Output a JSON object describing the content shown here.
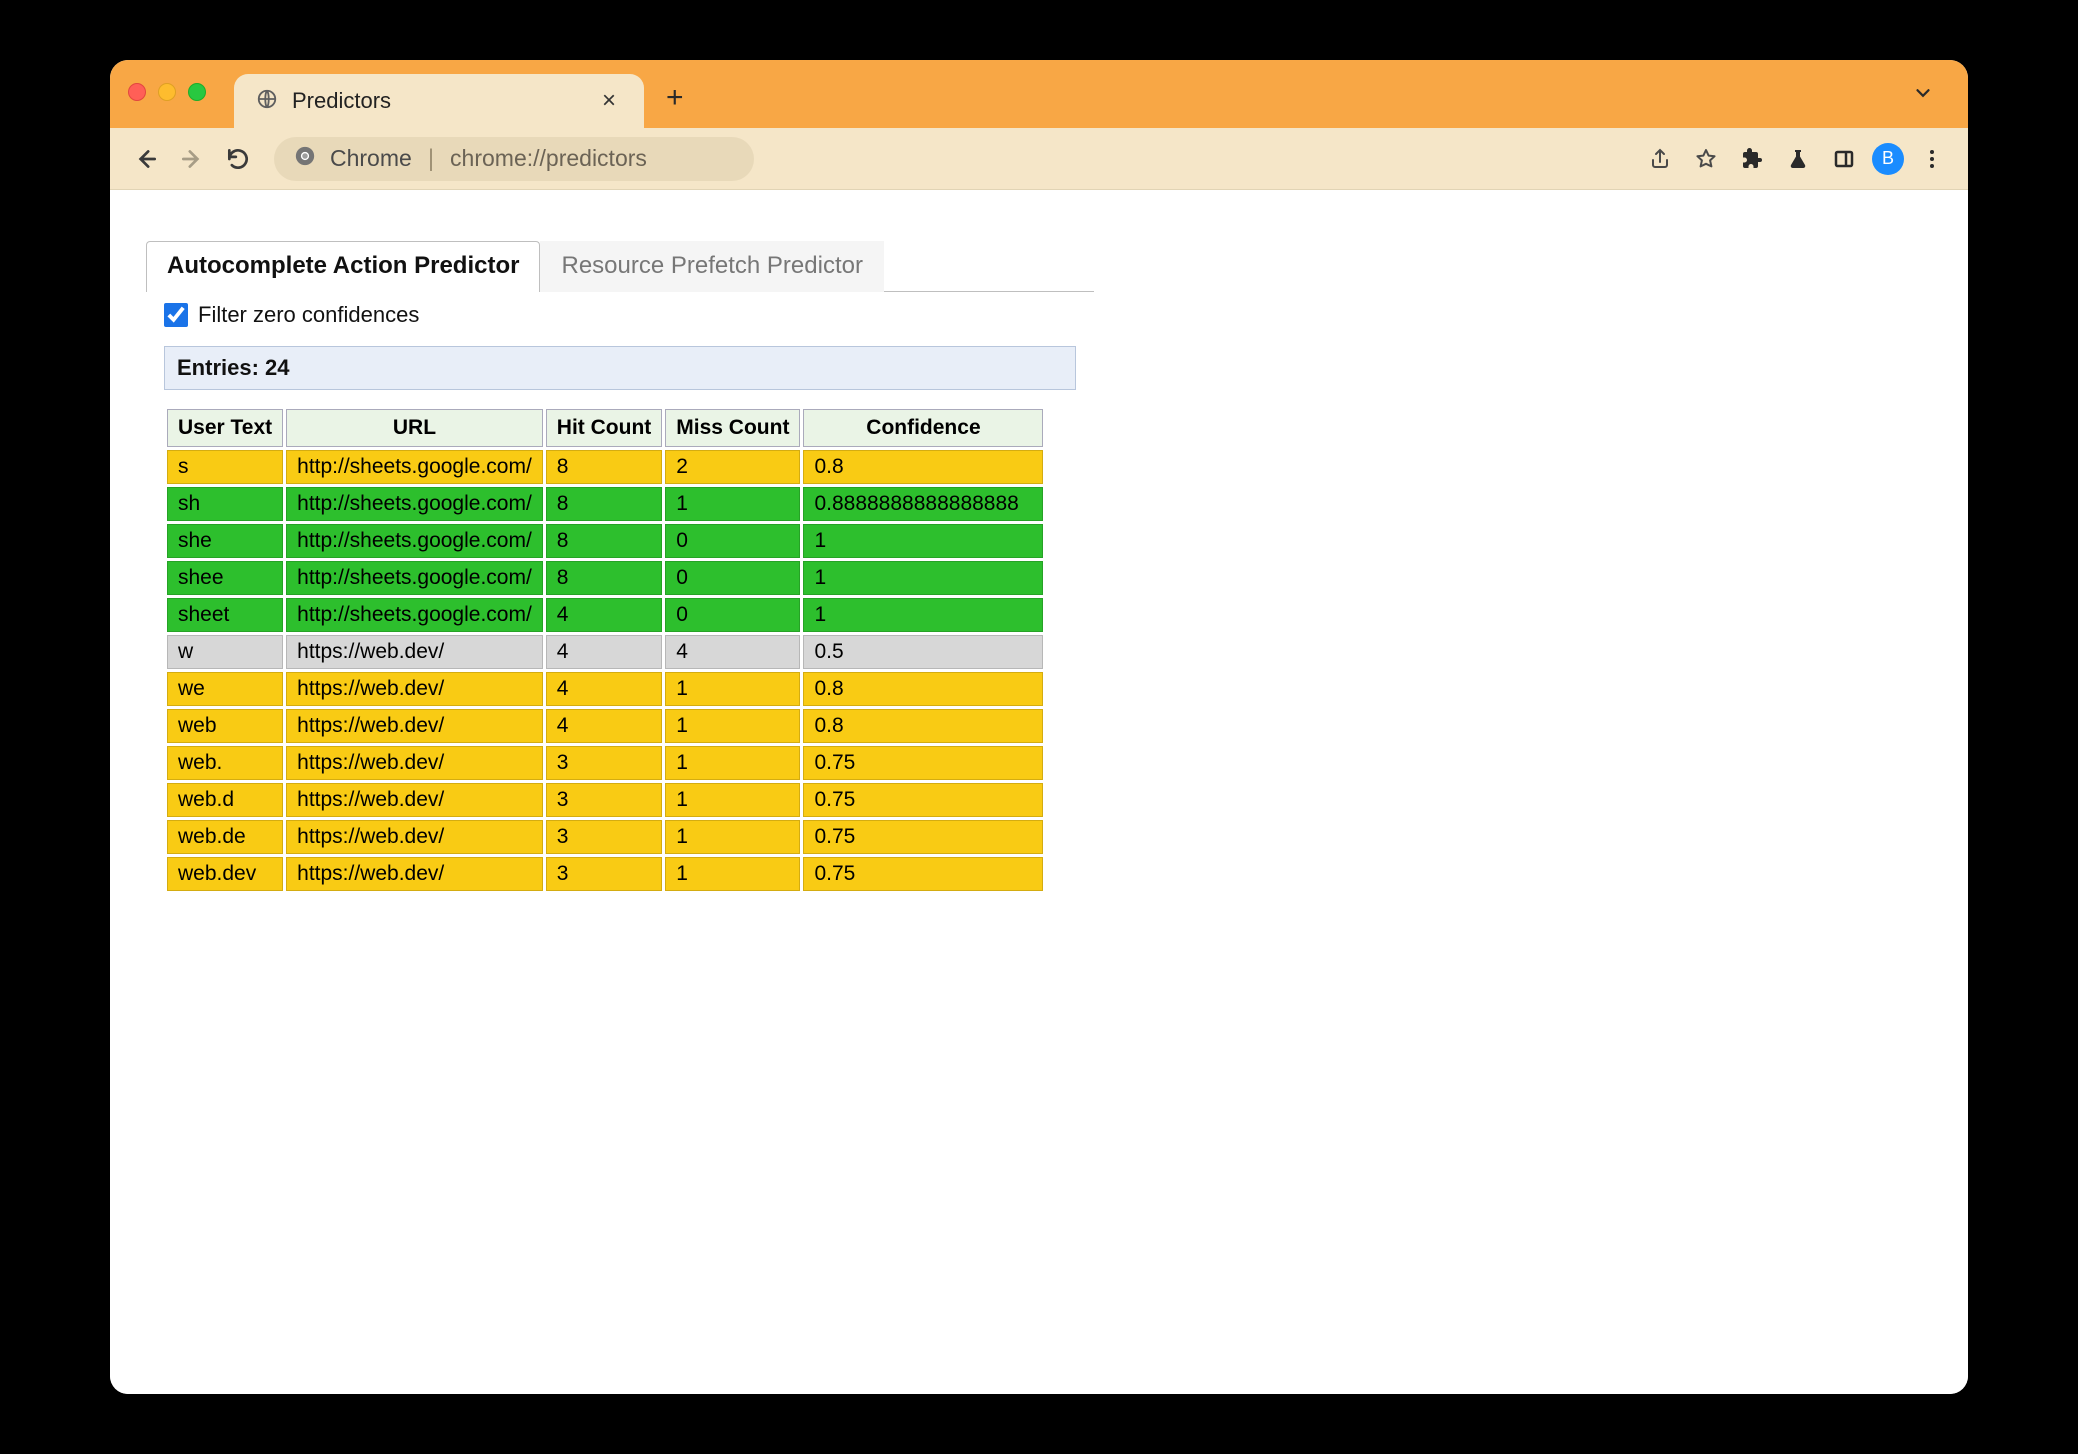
{
  "browser": {
    "tab_title": "Predictors",
    "omnibox_label": "Chrome",
    "omnibox_url": "chrome://predictors",
    "avatar_letter": "B"
  },
  "tabs": {
    "active": "Autocomplete Action Predictor",
    "inactive": "Resource Prefetch Predictor"
  },
  "filter": {
    "label": "Filter zero confidences",
    "checked": true
  },
  "entries_label": "Entries: 24",
  "columns": [
    "User Text",
    "URL",
    "Hit Count",
    "Miss Count",
    "Confidence"
  ],
  "rows": [
    {
      "user_text": "s",
      "url": "http://sheets.google.com/",
      "hit": "8",
      "miss": "2",
      "conf": "0.8",
      "tone": "yellow"
    },
    {
      "user_text": "sh",
      "url": "http://sheets.google.com/",
      "hit": "8",
      "miss": "1",
      "conf": "0.8888888888888888",
      "tone": "green"
    },
    {
      "user_text": "she",
      "url": "http://sheets.google.com/",
      "hit": "8",
      "miss": "0",
      "conf": "1",
      "tone": "green"
    },
    {
      "user_text": "shee",
      "url": "http://sheets.google.com/",
      "hit": "8",
      "miss": "0",
      "conf": "1",
      "tone": "green"
    },
    {
      "user_text": "sheet",
      "url": "http://sheets.google.com/",
      "hit": "4",
      "miss": "0",
      "conf": "1",
      "tone": "green"
    },
    {
      "user_text": "w",
      "url": "https://web.dev/",
      "hit": "4",
      "miss": "4",
      "conf": "0.5",
      "tone": "grey"
    },
    {
      "user_text": "we",
      "url": "https://web.dev/",
      "hit": "4",
      "miss": "1",
      "conf": "0.8",
      "tone": "yellow"
    },
    {
      "user_text": "web",
      "url": "https://web.dev/",
      "hit": "4",
      "miss": "1",
      "conf": "0.8",
      "tone": "yellow"
    },
    {
      "user_text": "web.",
      "url": "https://web.dev/",
      "hit": "3",
      "miss": "1",
      "conf": "0.75",
      "tone": "yellow"
    },
    {
      "user_text": "web.d",
      "url": "https://web.dev/",
      "hit": "3",
      "miss": "1",
      "conf": "0.75",
      "tone": "yellow"
    },
    {
      "user_text": "web.de",
      "url": "https://web.dev/",
      "hit": "3",
      "miss": "1",
      "conf": "0.75",
      "tone": "yellow"
    },
    {
      "user_text": "web.dev",
      "url": "https://web.dev/",
      "hit": "3",
      "miss": "1",
      "conf": "0.75",
      "tone": "yellow"
    }
  ]
}
